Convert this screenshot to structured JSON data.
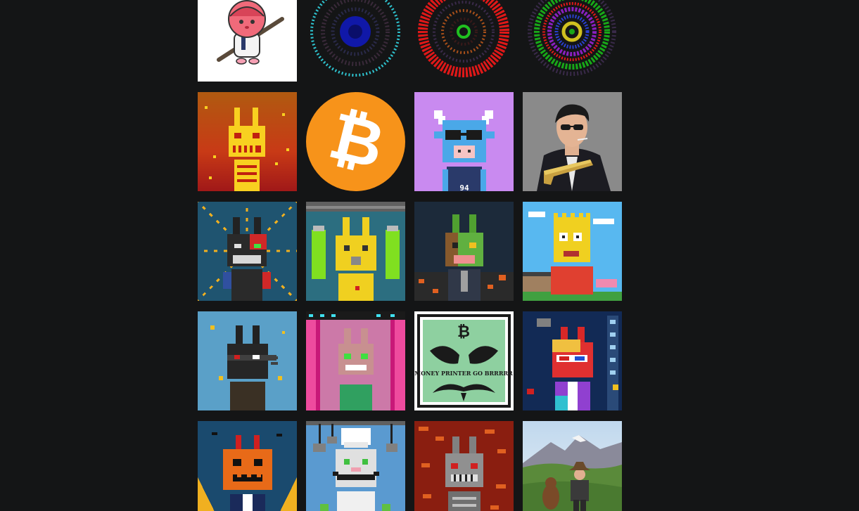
{
  "gallery": {
    "items": [
      {
        "name": "pink-helmet-samurai",
        "bg": "#ffffff"
      },
      {
        "name": "blue-cyan-rings",
        "bg": "#141516"
      },
      {
        "name": "red-orange-green-rings",
        "bg": "#141516"
      },
      {
        "name": "green-purple-rings",
        "bg": "#141516"
      },
      {
        "name": "fire-skeleton-bunny",
        "bg": "#c0401a"
      },
      {
        "name": "bitcoin-logo",
        "bg": "#f7931a",
        "glyph": "₿"
      },
      {
        "name": "blue-bull-sunglasses",
        "bg": "#c98af0",
        "jersey": "94"
      },
      {
        "name": "gangster-gold-gun",
        "bg": "#8a8a8a"
      },
      {
        "name": "cyborg-black-bunny",
        "bg": "#1f5470"
      },
      {
        "name": "yellow-toxic-bunny",
        "bg": "#2c6e80"
      },
      {
        "name": "zombie-green-bunny",
        "bg": "#1c2a3a"
      },
      {
        "name": "yellow-cartoon-boy",
        "bg": "#58b8f0"
      },
      {
        "name": "ninja-black-bunny",
        "bg": "#5aa0c8"
      },
      {
        "name": "pink-cage-bunny",
        "bg": "#ee4b9e"
      },
      {
        "name": "money-printer-mask",
        "bg": "#ffffff",
        "caption": "MONEY PRINTER GO BRRRRR",
        "glyph": "₿"
      },
      {
        "name": "red-3d-glasses-bunny",
        "bg": "#122a55"
      },
      {
        "name": "pumpkin-bunny",
        "bg": "#1a4a6e"
      },
      {
        "name": "chef-mustache-bunny",
        "bg": "#5a9ad0"
      },
      {
        "name": "grey-skeleton-bunny",
        "bg": "#8a1e10"
      },
      {
        "name": "cowboy-bigfoot-mountains",
        "bg": "#9ec0e0"
      }
    ]
  }
}
